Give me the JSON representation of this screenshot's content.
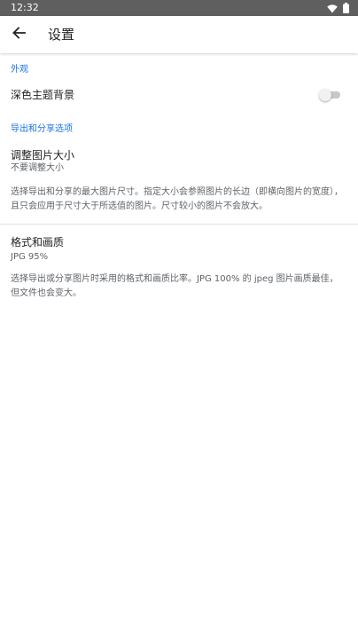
{
  "status_bar": {
    "time": "12:32",
    "icons": [
      "wifi-icon",
      "battery-icon"
    ]
  },
  "app_bar": {
    "back_icon": "arrow-back-icon",
    "title": "设置"
  },
  "sections": {
    "appearance": {
      "header": "外观",
      "dark_theme": {
        "title": "深色主题背景",
        "enabled": false
      }
    },
    "export_share": {
      "header": "导出和分享选项",
      "resize": {
        "title": "调整图片大小",
        "summary": "不要调整大小",
        "description": "选择导出和分享的最大图片尺寸。指定大小会参照图片的长边（即横向图片的宽度），且只会应用于尺寸大于所选值的图片。尺寸较小的图片不会放大。"
      },
      "format": {
        "title": "格式和画质",
        "summary": "JPG 95%",
        "description": "选择导出或分享图片时采用的格式和画质比率。JPG 100% 的 jpeg 图片画质最佳，但文件也会变大。"
      }
    }
  },
  "colors": {
    "accent": "#1a73e8",
    "status_bar": "#5f5f5f",
    "switch_off_track": "#c8c8c8"
  }
}
